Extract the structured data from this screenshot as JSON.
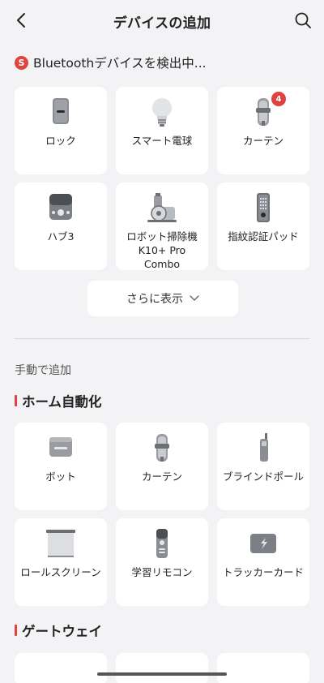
{
  "header": {
    "title": "デバイスの追加",
    "back_icon": "chevron-left-icon",
    "search_icon": "search-icon"
  },
  "scan": {
    "badge": "S",
    "text": "Bluetoothデバイスを検出中..."
  },
  "discovered": [
    {
      "label": "ロック",
      "icon": "lock-icon"
    },
    {
      "label": "スマート電球",
      "icon": "bulb-icon"
    },
    {
      "label": "カーテン",
      "icon": "curtain-icon",
      "badge": "4"
    },
    {
      "label": "ハブ3",
      "icon": "hub-icon"
    },
    {
      "label": "ロボット掃除機 K10+ Pro Combo",
      "icon": "robot-vacuum-icon"
    },
    {
      "label": "指紋認証パッド",
      "icon": "keypad-icon"
    }
  ],
  "more_button": {
    "label": "さらに表示"
  },
  "manual": {
    "label": "手動で追加"
  },
  "sections": {
    "home_automation": {
      "title": "ホーム自動化",
      "items": [
        {
          "label": "ボット",
          "icon": "bot-icon"
        },
        {
          "label": "カーテン",
          "icon": "curtain-icon"
        },
        {
          "label": "ブラインドポール",
          "icon": "blind-tilt-icon"
        },
        {
          "label": "ロールスクリーン",
          "icon": "roller-shade-icon"
        },
        {
          "label": "学習リモコン",
          "icon": "remote-icon"
        },
        {
          "label": "トラッカーカード",
          "icon": "tracker-card-icon"
        }
      ]
    },
    "gateway": {
      "title": "ゲートウェイ"
    }
  },
  "colors": {
    "accent": "#e0433f",
    "background": "#f3f3f5",
    "card": "#ffffff"
  }
}
